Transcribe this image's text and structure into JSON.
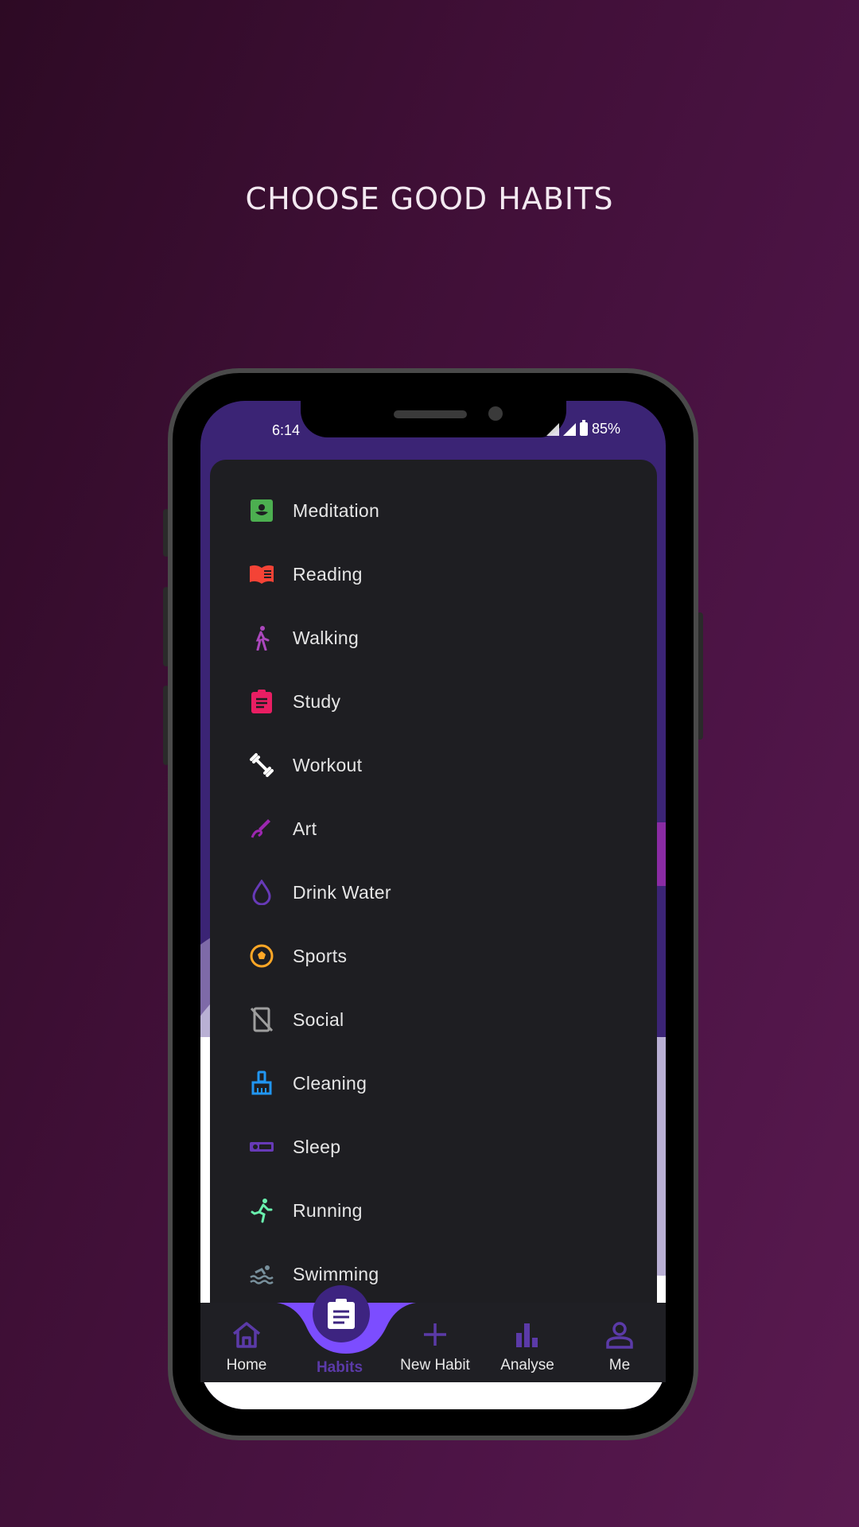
{
  "headline": "CHOOSE GOOD HABITS",
  "status_bar": {
    "time": "6:14",
    "battery": "85%"
  },
  "habits": [
    {
      "label": "Meditation",
      "icon": "meditation-icon",
      "color": "#4caf50"
    },
    {
      "label": "Reading",
      "icon": "book-icon",
      "color": "#f44336"
    },
    {
      "label": "Walking",
      "icon": "walking-icon",
      "color": "#ab47bc"
    },
    {
      "label": "Study",
      "icon": "clipboard-icon",
      "color": "#e91e63"
    },
    {
      "label": "Workout",
      "icon": "dumbbell-icon",
      "color": "#ffffff"
    },
    {
      "label": "Art",
      "icon": "draw-icon",
      "color": "#9c27b0"
    },
    {
      "label": "Drink Water",
      "icon": "water-drop-icon",
      "color": "#673ab7"
    },
    {
      "label": "Sports",
      "icon": "soccer-ball-icon",
      "color": "#ffa726"
    },
    {
      "label": "Social",
      "icon": "phone-off-icon",
      "color": "#9e9e9e"
    },
    {
      "label": "Cleaning",
      "icon": "broom-icon",
      "color": "#2196f3"
    },
    {
      "label": "Sleep",
      "icon": "bed-icon",
      "color": "#673ab7"
    },
    {
      "label": "Running",
      "icon": "running-icon",
      "color": "#69f0ae"
    },
    {
      "label": "Swimming",
      "icon": "swimming-icon",
      "color": "#78909c"
    }
  ],
  "bottom_nav": {
    "home": "Home",
    "habits": "Habits",
    "new_habit": "New Habit",
    "analyse": "Analyse",
    "me": "Me"
  },
  "colors": {
    "accent": "#7c4dff",
    "nav_active": "#5b3aa8",
    "sheet": "#1e1e22"
  }
}
